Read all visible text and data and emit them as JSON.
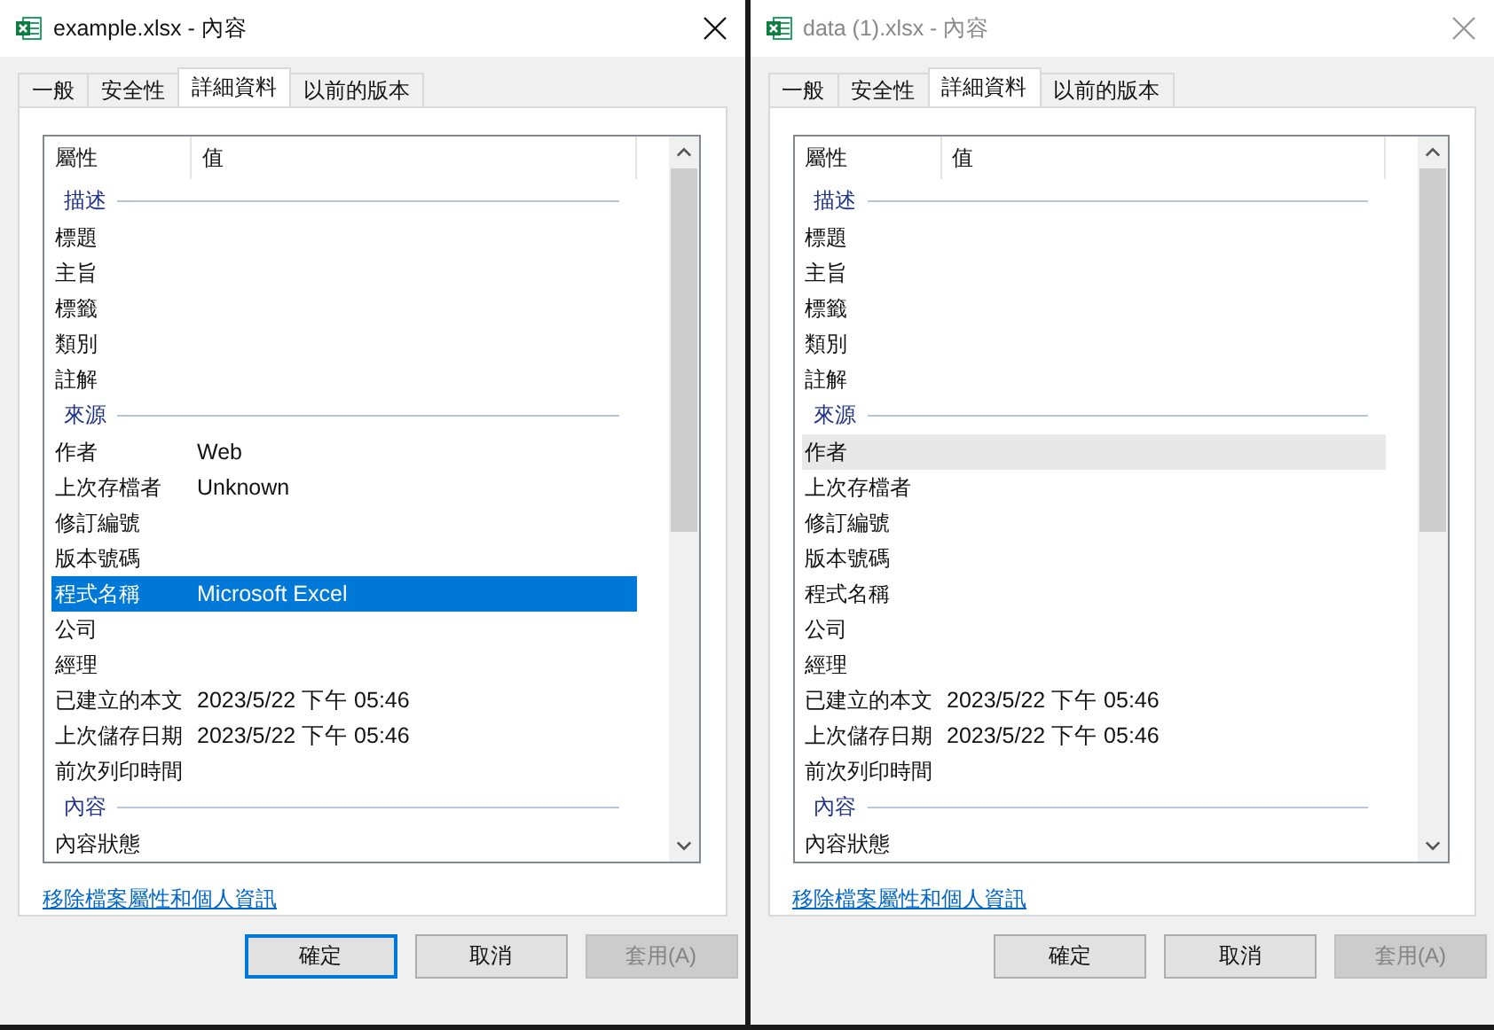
{
  "dialogs": [
    {
      "title": "example.xlsx - 內容",
      "active": true,
      "tabs": [
        {
          "label": "一般",
          "selected": false
        },
        {
          "label": "安全性",
          "selected": false
        },
        {
          "label": "詳細資料",
          "selected": true
        },
        {
          "label": "以前的版本",
          "selected": false
        }
      ],
      "columns": [
        "屬性",
        "值"
      ],
      "rows": [
        {
          "kind": "group",
          "label": "描述"
        },
        {
          "kind": "prop",
          "label": "標題",
          "selected": false,
          "hovered": false
        },
        {
          "kind": "prop",
          "label": "主旨",
          "selected": false,
          "hovered": false
        },
        {
          "kind": "prop",
          "label": "標籤",
          "selected": false,
          "hovered": false
        },
        {
          "kind": "prop",
          "label": "類別",
          "selected": false,
          "hovered": false
        },
        {
          "kind": "prop",
          "label": "註解",
          "selected": false,
          "hovered": false
        },
        {
          "kind": "group",
          "label": "來源"
        },
        {
          "kind": "prop",
          "label": "作者",
          "value": "Web",
          "selected": false,
          "hovered": false
        },
        {
          "kind": "prop",
          "label": "上次存檔者",
          "value": "Unknown",
          "selected": false,
          "hovered": false
        },
        {
          "kind": "prop",
          "label": "修訂編號",
          "selected": false,
          "hovered": false
        },
        {
          "kind": "prop",
          "label": "版本號碼",
          "selected": false,
          "hovered": false
        },
        {
          "kind": "prop",
          "label": "程式名稱",
          "value": "Microsoft Excel",
          "selected": true,
          "hovered": false
        },
        {
          "kind": "prop",
          "label": "公司",
          "selected": false,
          "hovered": false
        },
        {
          "kind": "prop",
          "label": "經理",
          "selected": false,
          "hovered": false
        },
        {
          "kind": "prop",
          "label": "已建立的本文",
          "value": "2023/5/22 下午 05:46",
          "selected": false,
          "hovered": false
        },
        {
          "kind": "prop",
          "label": "上次儲存日期",
          "value": "2023/5/22 下午 05:46",
          "selected": false,
          "hovered": false
        },
        {
          "kind": "prop",
          "label": "前次列印時間",
          "selected": false,
          "hovered": false
        },
        {
          "kind": "group",
          "label": "內容"
        },
        {
          "kind": "prop",
          "label": "內容狀態",
          "selected": false,
          "hovered": false
        }
      ],
      "link": "移除檔案屬性和個人資訊",
      "buttons": [
        {
          "label": "確定",
          "default": true,
          "disabled": false
        },
        {
          "label": "取消",
          "default": false,
          "disabled": false
        },
        {
          "label": "套用(A)",
          "default": false,
          "disabled": true
        }
      ]
    },
    {
      "title": "data (1).xlsx - 內容",
      "active": false,
      "tabs": [
        {
          "label": "一般",
          "selected": false
        },
        {
          "label": "安全性",
          "selected": false
        },
        {
          "label": "詳細資料",
          "selected": true
        },
        {
          "label": "以前的版本",
          "selected": false
        }
      ],
      "columns": [
        "屬性",
        "值"
      ],
      "rows": [
        {
          "kind": "group",
          "label": "描述"
        },
        {
          "kind": "prop",
          "label": "標題",
          "selected": false,
          "hovered": false
        },
        {
          "kind": "prop",
          "label": "主旨",
          "selected": false,
          "hovered": false
        },
        {
          "kind": "prop",
          "label": "標籤",
          "selected": false,
          "hovered": false
        },
        {
          "kind": "prop",
          "label": "類別",
          "selected": false,
          "hovered": false
        },
        {
          "kind": "prop",
          "label": "註解",
          "selected": false,
          "hovered": false
        },
        {
          "kind": "group",
          "label": "來源"
        },
        {
          "kind": "prop",
          "label": "作者",
          "selected": false,
          "hovered": true
        },
        {
          "kind": "prop",
          "label": "上次存檔者",
          "selected": false,
          "hovered": false
        },
        {
          "kind": "prop",
          "label": "修訂編號",
          "selected": false,
          "hovered": false
        },
        {
          "kind": "prop",
          "label": "版本號碼",
          "selected": false,
          "hovered": false
        },
        {
          "kind": "prop",
          "label": "程式名稱",
          "selected": false,
          "hovered": false
        },
        {
          "kind": "prop",
          "label": "公司",
          "selected": false,
          "hovered": false
        },
        {
          "kind": "prop",
          "label": "經理",
          "selected": false,
          "hovered": false
        },
        {
          "kind": "prop",
          "label": "已建立的本文",
          "value": "2023/5/22 下午 05:46",
          "selected": false,
          "hovered": false
        },
        {
          "kind": "prop",
          "label": "上次儲存日期",
          "value": "2023/5/22 下午 05:46",
          "selected": false,
          "hovered": false
        },
        {
          "kind": "prop",
          "label": "前次列印時間",
          "selected": false,
          "hovered": false
        },
        {
          "kind": "group",
          "label": "內容"
        },
        {
          "kind": "prop",
          "label": "內容狀態",
          "selected": false,
          "hovered": false
        }
      ],
      "link": "移除檔案屬性和個人資訊",
      "buttons": [
        {
          "label": "確定",
          "default": false,
          "disabled": false
        },
        {
          "label": "取消",
          "default": false,
          "disabled": false
        },
        {
          "label": "套用(A)",
          "default": false,
          "disabled": true
        }
      ]
    }
  ]
}
